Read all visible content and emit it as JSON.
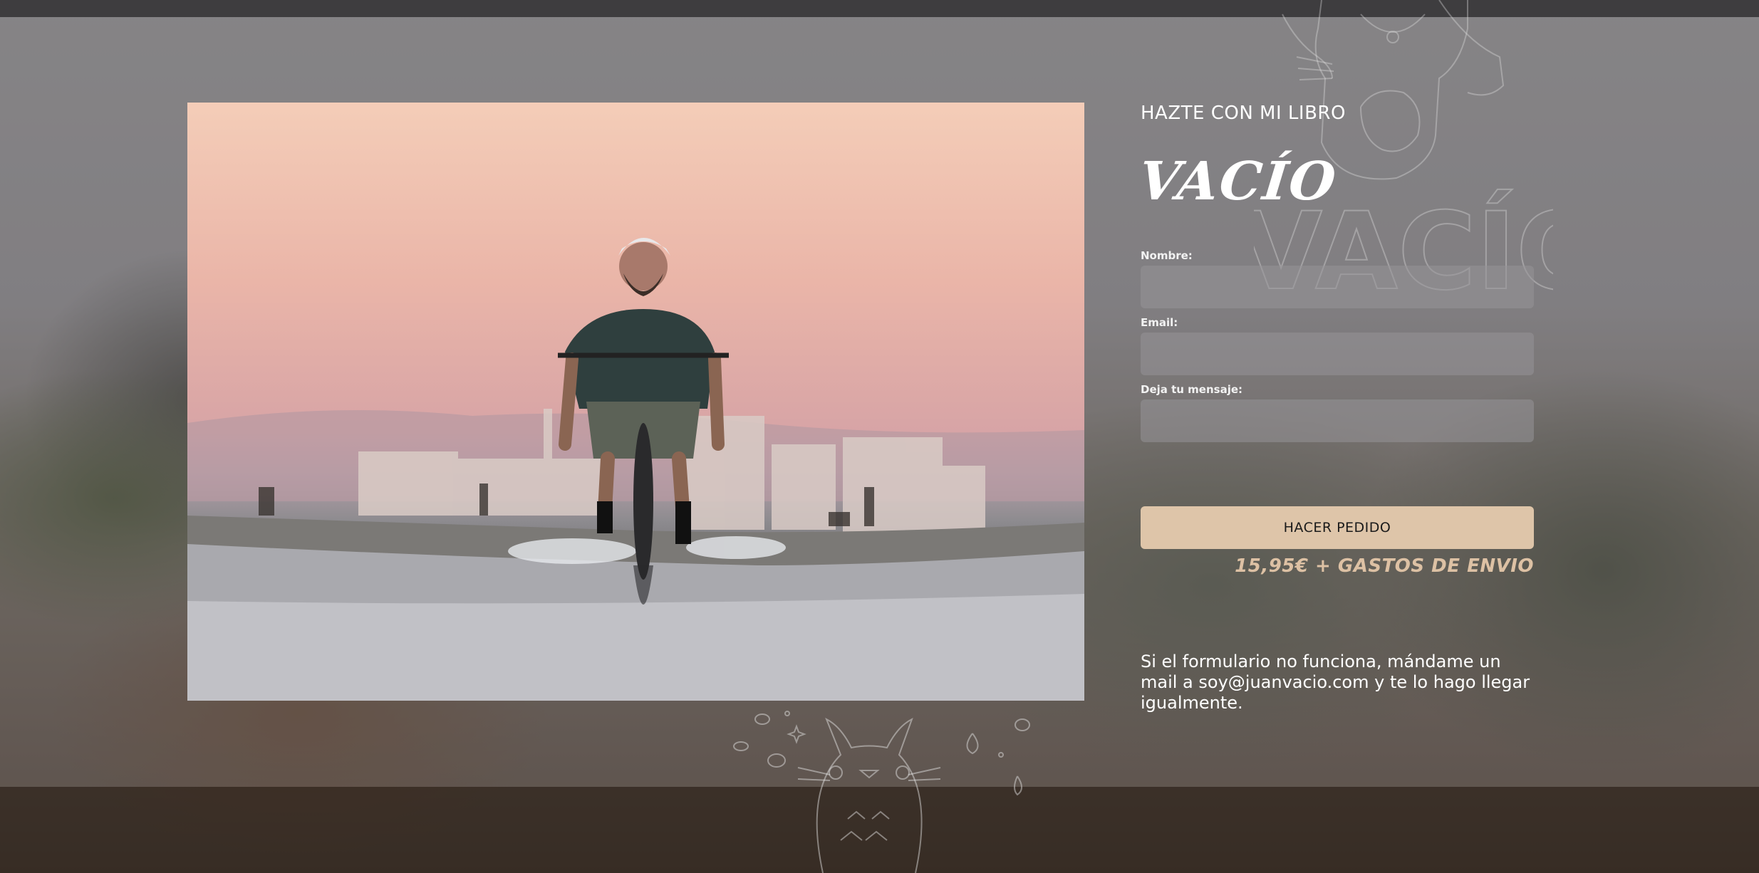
{
  "order_panel": {
    "eyebrow": "HAZTE CON MI LIBRO",
    "logo_text": "VACÍO",
    "fields": {
      "name_label": "Nombre:",
      "email_label": "Email:",
      "message_label": "Deja tu mensaje:"
    },
    "submit_label": "HACER PEDIDO",
    "price": "15,95€ + GASTOS DE ENVIO",
    "note": "Si el formulario no funciona, mándame un mail a soy@juanvacio.com y te lo hago llegar igualmente."
  },
  "decor": {
    "background_lineart_text": "VACÍO"
  },
  "colors": {
    "button_bg": "#dec5a9",
    "price_text": "#ddc1a4",
    "field_bg": "#969498"
  }
}
